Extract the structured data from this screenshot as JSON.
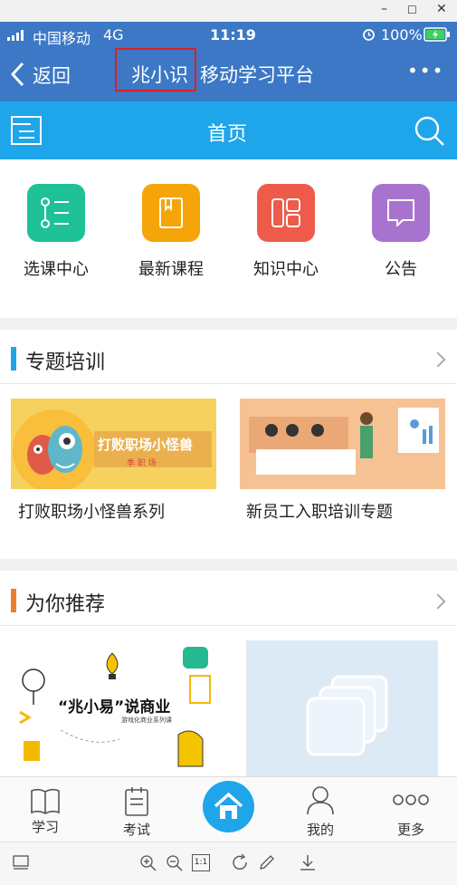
{
  "window": {
    "minimize": "–",
    "maximize": "☐",
    "close": "✕"
  },
  "status": {
    "carrier": "中国移动",
    "network": "4G",
    "time": "11:19",
    "battery": "100%"
  },
  "nav": {
    "back_label": "返回",
    "title_highlight": "兆小识",
    "title_rest": "移动学习平台",
    "more": "•••"
  },
  "header": {
    "title": "首页"
  },
  "shortcuts": [
    {
      "label": "选课中心",
      "color": "#1fc197"
    },
    {
      "label": "最新课程",
      "color": "#f5a50a"
    },
    {
      "label": "知识中心",
      "color": "#ee5b4b"
    },
    {
      "label": "公告",
      "color": "#a873cf"
    }
  ],
  "sections": {
    "topics": {
      "title": "专题培训",
      "accent": "#1ea5ea",
      "cards": [
        {
          "title": "打败职场小怪兽系列",
          "banner_text": "打败职场小怪兽",
          "banner_sub": "季 职 场"
        },
        {
          "title": "新员工入职培训专题"
        }
      ]
    },
    "recommend": {
      "title": "为你推荐",
      "accent": "#f07d2f",
      "cards": [
        {
          "banner_text": "“兆小易”说商业",
          "banner_sub": "游戏化商业系列课"
        },
        {}
      ]
    }
  },
  "tabbar": {
    "tabs": [
      {
        "label": "学习",
        "icon": "book-icon"
      },
      {
        "label": "考试",
        "icon": "exam-icon"
      },
      {
        "label": "",
        "icon": "home-icon"
      },
      {
        "label": "我的",
        "icon": "user-icon"
      },
      {
        "label": "更多",
        "icon": "more-icon"
      }
    ]
  },
  "viewer": {
    "fit": "1:1"
  },
  "colors": {
    "status_bar": "#3c78c6",
    "header": "#1ea5ea",
    "home_button": "#1ea5ea",
    "highlight_box": "#e02020"
  }
}
